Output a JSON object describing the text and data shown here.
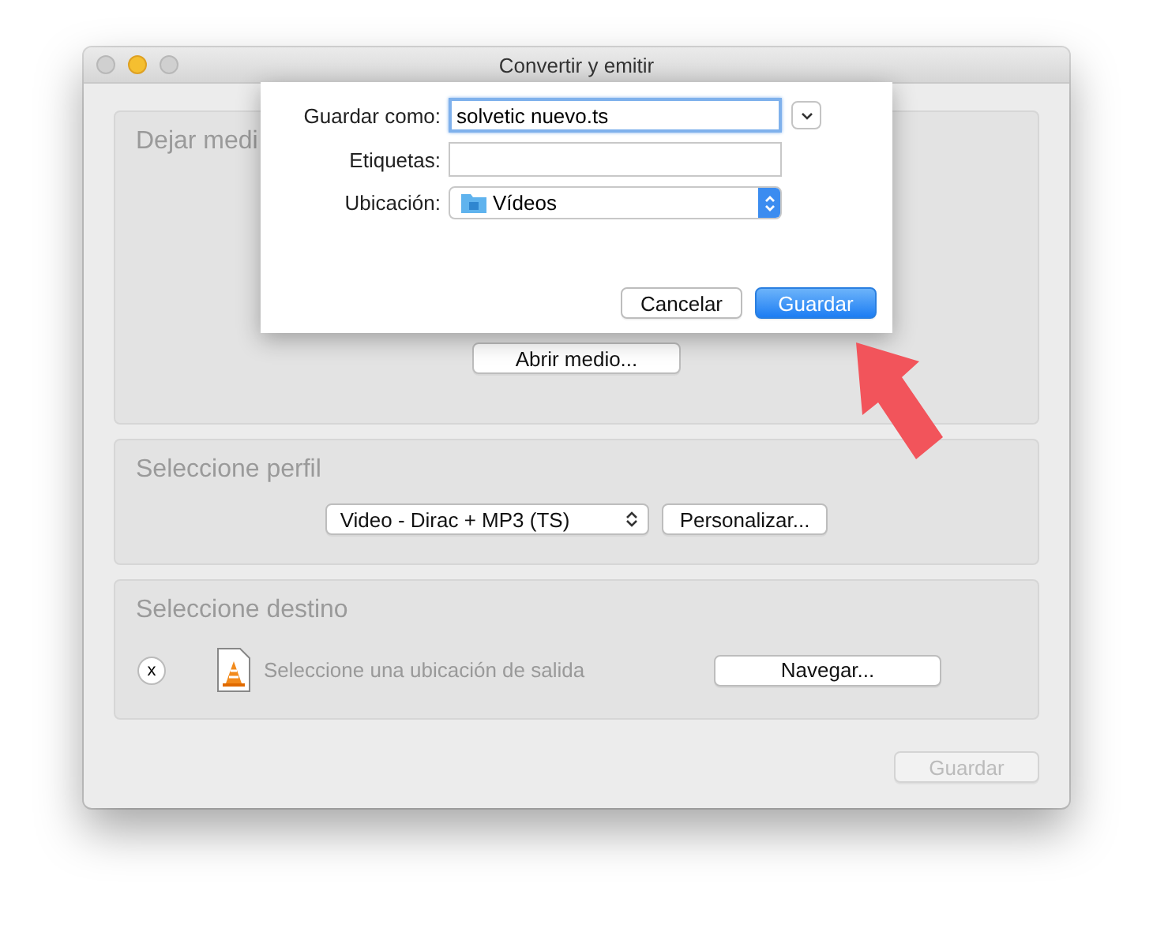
{
  "window": {
    "title": "Convertir y emitir"
  },
  "sections": [
    {
      "kind": "media",
      "title": "Dejar medi",
      "button": "Abrir medio..."
    },
    {
      "kind": "profile",
      "title": "Seleccione perfil",
      "select": "Video - Dirac + MP3 (TS)",
      "button": "Personalizar..."
    },
    {
      "kind": "destination",
      "title": "Seleccione destino",
      "clear": "x",
      "placeholder": "Seleccione una ubicación de salida",
      "button": "Navegar..."
    }
  ],
  "footer_button": {
    "label": "Guardar",
    "disabled": true
  },
  "save_sheet": {
    "fields": [
      {
        "kind": "text",
        "label": "Guardar como:",
        "value": "solvetic nuevo.ts",
        "focused": true
      },
      {
        "kind": "text",
        "label": "Etiquetas:",
        "focused": false
      },
      {
        "kind": "popup",
        "label": "Ubicación:",
        "value": "Vídeos"
      }
    ],
    "buttons": [
      {
        "label": "Cancelar",
        "default": false
      },
      {
        "label": "Guardar",
        "default": true
      }
    ]
  }
}
